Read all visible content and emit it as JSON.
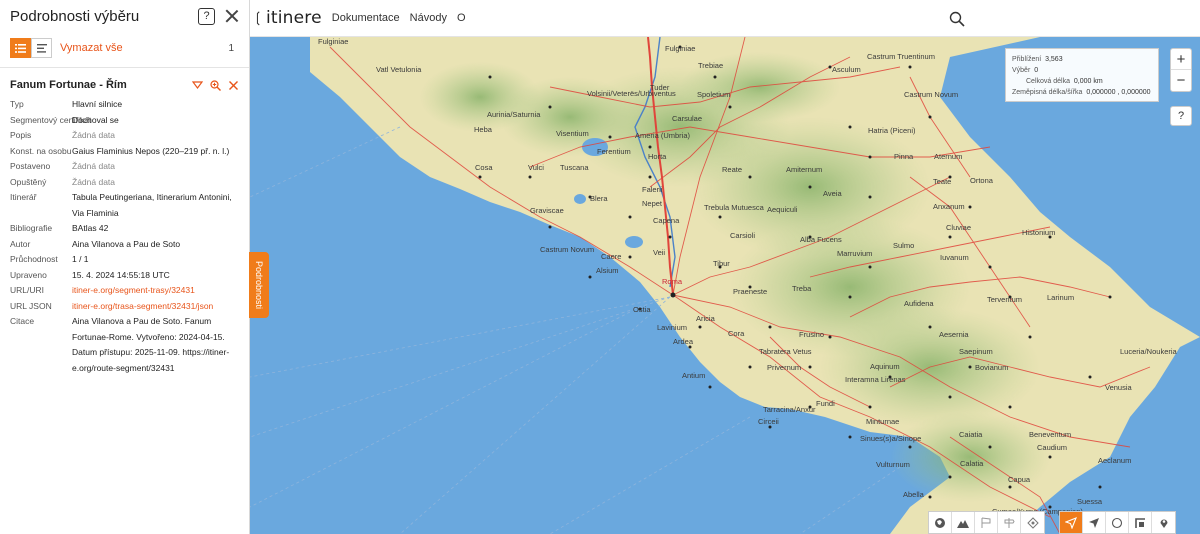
{
  "app": {
    "logo": "itinere"
  },
  "nav": [
    "Dokumentace",
    "Návody",
    "O"
  ],
  "panel": {
    "title": "Podrobnosti výběru",
    "help": "?",
    "clear_label": "Vymazat vše",
    "count": "1",
    "item_title": "Fanum Fortunae - Řím",
    "details_tab": "Podrobnosti"
  },
  "props": [
    {
      "k": "Typ",
      "v": "Hlavní silnice",
      "style": ""
    },
    {
      "k": "Segmentový certifikát",
      "v": "Dochoval se",
      "style": ""
    },
    {
      "k": "Popis",
      "v": "Žádná data",
      "style": "muted"
    },
    {
      "k": "Konst. na osobu",
      "v": "Gaius Flaminius Nepos (220–219 př. n. l.)",
      "style": ""
    },
    {
      "k": "Postaveno",
      "v": "Žádná data",
      "style": "muted"
    },
    {
      "k": "Opuštěný",
      "v": "Žádná data",
      "style": "muted"
    },
    {
      "k": "Itinerář",
      "v": "Tabula Peutingeriana, Itinerarium Antonini, Via Flaminia",
      "style": ""
    },
    {
      "k": "Bibliografie",
      "v": "BAtlas 42",
      "style": ""
    },
    {
      "k": "Autor",
      "v": "Aina Vilanova a Pau de Soto",
      "style": ""
    },
    {
      "k": "Průchodnost",
      "v": "1 / 1",
      "style": ""
    },
    {
      "k": "Upraveno",
      "v": "15. 4. 2024 14:55:18 UTC",
      "style": ""
    },
    {
      "k": "URL/URI",
      "v": "itiner-e.org/segment-trasy/32431",
      "style": "link"
    },
    {
      "k": "URL JSON",
      "v": "itiner-e.org/trasa-segment/32431/json",
      "style": "link"
    },
    {
      "k": "Citace",
      "v": "Aina Vilanova a Pau de Soto. Fanum Fortunae-Rome. Vytvořeno: 2024-04-15. Datum přístupu: 2025-11-09. https://itiner-e.org/route-segment/32431",
      "style": ""
    }
  ],
  "info": {
    "zoom_label": "Přiblížení",
    "zoom_value": "3,563",
    "selection_label": "Výběr",
    "selection_value": "0",
    "length_label": "Celková délka",
    "length_value": "0,000 km",
    "coords_label": "Zeměpisná délka/šířka",
    "coords_value": "0,000000 , 0,000000"
  },
  "colors": {
    "accent": "#f07c1a",
    "link": "#e8551b",
    "sea": "#6aa8de",
    "land": "#e9e3b4",
    "road": "#e0453b"
  },
  "places": [
    "Fulginiae",
    "Trebiae",
    "Asculum",
    "Castrum Truentinum",
    "Vatl Vetulonia",
    "Aurinia/Saturnia",
    "Volsinii/Veterës/Urbiventus",
    "Tuder",
    "Spoletium",
    "Castrum Novum",
    "Heba",
    "Carsulae",
    "Visentium",
    "Ameria (Umbria)",
    "Hatria (Piceni)",
    "Ferentium",
    "Horta",
    "Pinna",
    "Aternum",
    "Cosa",
    "Vulci",
    "Tuscana",
    "Reate",
    "Amiternum",
    "Teate",
    "Ortona",
    "Falerii",
    "Aveia",
    "Anxanum",
    "Graviscae",
    "Blera",
    "Nepet",
    "Trebula Mutuesca",
    "Aequiculi",
    "Cluviae",
    "Capena",
    "Carsioli",
    "Alba Fucens",
    "Sulmo",
    "Iuvanum",
    "Histonium",
    "Castrum Novum",
    "Caere",
    "Veii",
    "Tibur",
    "Marruvium",
    "Terventum",
    "Larinum",
    "Alsium",
    "Roma",
    "Praeneste",
    "Treba",
    "Aufidena",
    "Ostia",
    "Lavinium",
    "Aricia",
    "Cora",
    "Frusino",
    "Aesernia",
    "Saepinum",
    "Ardea",
    "Tabratera Vetus",
    "Aquinum",
    "Bovianum",
    "Luceria/Noukeria",
    "Antium",
    "Privernum",
    "Interamna Lirenas",
    "Venusia",
    "Tarracina/Anxur",
    "Fundi",
    "Aeclanum",
    "Circeii",
    "Minturnae",
    "Caiatia",
    "Beneventum",
    "Sinues(s)a/Sinope",
    "Caudium",
    "Vulturnum",
    "Calatia",
    "Capua",
    "Abella",
    "Cumae/Kyme (Campanian)",
    "Suessa",
    "Puteoli",
    "Frequentum"
  ]
}
